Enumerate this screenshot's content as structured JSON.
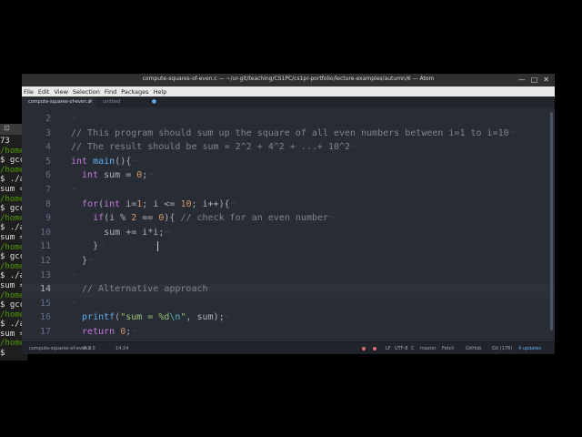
{
  "window": {
    "title": "compute-squares-of-even.c — ~/ur-git/teaching/CS1PC/cs1pr-portfolio/lecture-examples/autumn/6 — Atom",
    "minimize": "—",
    "maximize": "□",
    "close": "✕"
  },
  "menu": [
    "File",
    "Edit",
    "View",
    "Selection",
    "Find",
    "Packages",
    "Help"
  ],
  "tabs": [
    {
      "label": "compute-squares-of-even.c",
      "active": true,
      "close": "×"
    },
    {
      "label": "untitled",
      "active": false,
      "modified": "●"
    }
  ],
  "editor": {
    "active_line": 14,
    "lines": [
      {
        "n": "2",
        "tokens": []
      },
      {
        "n": "3",
        "tokens": [
          {
            "t": "// This program should sum up the square of all even numbers between i=1 to i=10",
            "c": "cm"
          }
        ]
      },
      {
        "n": "4",
        "tokens": [
          {
            "t": "// The result should be sum = 2^2 + 4^2 + ...+ 10^2",
            "c": "cm"
          }
        ]
      },
      {
        "n": "5",
        "tokens": [
          {
            "t": "int",
            "c": "kw"
          },
          {
            "t": " "
          },
          {
            "t": "main",
            "c": "fn"
          },
          {
            "t": "(){"
          }
        ]
      },
      {
        "n": "6",
        "tokens": [
          {
            "t": "  int",
            "c": "kw"
          },
          {
            "t": " sum = "
          },
          {
            "t": "0",
            "c": "nm"
          },
          {
            "t": ";"
          }
        ]
      },
      {
        "n": "7",
        "tokens": []
      },
      {
        "n": "8",
        "tokens": [
          {
            "t": "  for",
            "c": "kw"
          },
          {
            "t": "("
          },
          {
            "t": "int",
            "c": "kw"
          },
          {
            "t": " i="
          },
          {
            "t": "1",
            "c": "nm"
          },
          {
            "t": "; i <= "
          },
          {
            "t": "10",
            "c": "nm"
          },
          {
            "t": "; i++){"
          }
        ]
      },
      {
        "n": "9",
        "tokens": [
          {
            "t": "    if",
            "c": "kw"
          },
          {
            "t": "(i % "
          },
          {
            "t": "2",
            "c": "nm"
          },
          {
            "t": " == "
          },
          {
            "t": "0",
            "c": "nm"
          },
          {
            "t": "){ "
          },
          {
            "t": "// check for an even number",
            "c": "cm"
          }
        ]
      },
      {
        "n": "10",
        "tokens": [
          {
            "t": "      sum += i*i;"
          }
        ]
      },
      {
        "n": "11",
        "tokens": [
          {
            "t": "    }"
          }
        ]
      },
      {
        "n": "12",
        "tokens": [
          {
            "t": "  }"
          }
        ]
      },
      {
        "n": "13",
        "tokens": []
      },
      {
        "n": "14",
        "tokens": [
          {
            "t": "  // Alternative approach",
            "c": "cm"
          }
        ]
      },
      {
        "n": "15",
        "tokens": []
      },
      {
        "n": "16",
        "tokens": [
          {
            "t": "  "
          },
          {
            "t": "printf",
            "c": "fn"
          },
          {
            "t": "("
          },
          {
            "t": "\"sum = %d",
            "c": "st"
          },
          {
            "t": "\\n",
            "c": "es"
          },
          {
            "t": "\"",
            "c": "st"
          },
          {
            "t": ", sum);"
          }
        ]
      },
      {
        "n": "17",
        "tokens": [
          {
            "t": "  return",
            "c": "kw"
          },
          {
            "t": " "
          },
          {
            "t": "0",
            "c": "nm"
          },
          {
            "t": ";"
          }
        ]
      }
    ]
  },
  "status": {
    "file": "compute-squares-of-even.c",
    "diag": "0  0  0",
    "position": "14:24",
    "line_ending": "LF",
    "encoding": "UTF-8",
    "grammar": "C",
    "branch": "master",
    "fetch": "Fetch",
    "github": "GitHub",
    "git": "Git (176)",
    "updates": "4 updates"
  },
  "terminal": {
    "tab_label": "⊡",
    "lines": [
      {
        "text": "73",
        "color": "#e0e0e0"
      },
      {
        "text": "/home",
        "color": "#4e9a06"
      },
      {
        "text": "$ gcc",
        "color": "#e0e0e0"
      },
      {
        "text": "/home",
        "color": "#4e9a06"
      },
      {
        "text": "$ ./a",
        "color": "#e0e0e0"
      },
      {
        "text": "sum =",
        "color": "#e0e0e0"
      },
      {
        "text": "/home",
        "color": "#4e9a06"
      },
      {
        "text": "$ gcc",
        "color": "#e0e0e0"
      },
      {
        "text": "/home",
        "color": "#4e9a06"
      },
      {
        "text": "$ ./a",
        "color": "#e0e0e0"
      },
      {
        "text": "sum =",
        "color": "#e0e0e0"
      },
      {
        "text": "/home",
        "color": "#4e9a06"
      },
      {
        "text": "$ gcc",
        "color": "#e0e0e0"
      },
      {
        "text": "/home",
        "color": "#4e9a06"
      },
      {
        "text": "$ ./a",
        "color": "#e0e0e0"
      },
      {
        "text": "sum =",
        "color": "#e0e0e0"
      },
      {
        "text": "/home",
        "color": "#4e9a06"
      },
      {
        "text": "$ gcc",
        "color": "#e0e0e0"
      },
      {
        "text": "/home",
        "color": "#4e9a06"
      },
      {
        "text": "$ ./a",
        "color": "#e0e0e0"
      },
      {
        "text": "sum =",
        "color": "#e0e0e0"
      },
      {
        "text": "/home",
        "color": "#4e9a06"
      },
      {
        "text": "$ ",
        "color": "#e0e0e0"
      }
    ]
  },
  "colors": {
    "editor_bg": "#282c34",
    "comment": "#7f848e",
    "keyword": "#c678dd",
    "number": "#d19a66",
    "function": "#61afef",
    "string": "#98c379"
  }
}
